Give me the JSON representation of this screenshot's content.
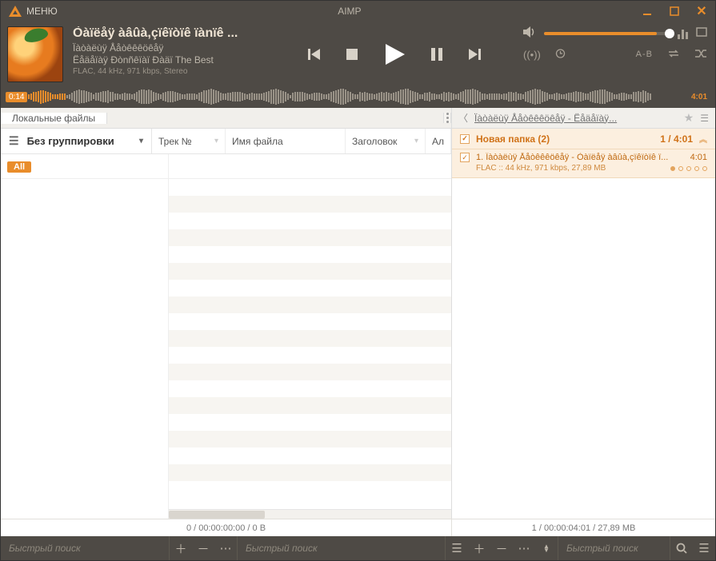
{
  "titlebar": {
    "menu": "МЕНЮ",
    "app_title": "AIMP"
  },
  "track": {
    "title": "Òàïëåÿ àâûà,çïêïòïê ïànïê ...",
    "artist": "Ïàòàëùÿ Ååòêêêöêåÿ",
    "album": "Ëåäåïàÿ Ðònñêïàï Ðàäï The Best",
    "tech": "FLAC, 44 kHz, 971 kbps, Stereo"
  },
  "waveform": {
    "pos": "0:14",
    "total": "4:01",
    "played_pct": 6
  },
  "volume": {
    "pct": 90
  },
  "extra_labels": {
    "ab": "A-B"
  },
  "tabs": {
    "left_tab": "Локальные файлы",
    "playlist_name": "Ïàòàëùÿ Ååòêêêöêåÿ - Ëåäåïàÿ..."
  },
  "grouping": {
    "label": "Без группировки",
    "all_chip": "All"
  },
  "columns": {
    "track_no": "Трек №",
    "file_name": "Имя файла",
    "title": "Заголовок",
    "album": "Ал"
  },
  "playlist": {
    "group_name": "Новая папка (2)",
    "group_summary": "1 / 4:01",
    "track_line": "1. Ïàòàëùÿ Ååòêêêöêåÿ - Òàïëåÿ àâûà,çïêïòïê ï...",
    "track_dur": "4:01",
    "track_tech": "FLAC :: 44 kHz, 971 kbps, 27,89 MB"
  },
  "status": {
    "left": "0 / 00:00:00:00 / 0 B",
    "right": "1 / 00:00:04:01 / 27,89 MB"
  },
  "bottom": {
    "search_ph": "Быстрый поиск"
  }
}
